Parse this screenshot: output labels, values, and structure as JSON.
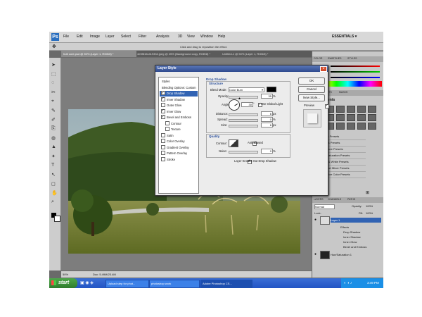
{
  "menubar": {
    "logo": "Ps",
    "items": [
      "File",
      "Edit",
      "Image",
      "Layer",
      "Select",
      "Filter",
      "Analysis",
      "3D",
      "View",
      "Window",
      "Help"
    ],
    "workspace": "ESSENTIALS ▾"
  },
  "options_bar": {
    "hint": "Click and drag to reposition the effect."
  },
  "doc_tabs": [
    "hutt core.psd @ 50% (Layer 1, RGB/8) *",
    "4e5f815c419332.jpeg @ 25% (Background copy, RGB/8) *",
    "Untitled-1 @ 50% (Layer 1, RGB/8) *"
  ],
  "status": {
    "zoom": "50%",
    "doc": "Doc: 5.49M/23.4M"
  },
  "panels": {
    "top_tabs": [
      "COLOR",
      "SWATCHES",
      "STYLES"
    ],
    "mid_tabs": [
      "ADJUSTMENTS",
      "MASKS"
    ],
    "adjustments_title": "Adjustments",
    "presets": [
      "Levels Presets",
      "Curves Presets",
      "Exposure Presets",
      "Hue/Saturation Presets",
      "Black & White Presets",
      "Channel Mixer Presets",
      "Selective Color Presets"
    ],
    "layer_tabs": [
      "LAYERS",
      "CHANNELS",
      "PATHS"
    ],
    "blend_mode": "Normal",
    "opacity_label": "Opacity:",
    "opacity_value": "100%",
    "lock_label": "Lock:",
    "fill_label": "Fill:",
    "fill_value": "100%",
    "layers": [
      "Layer 1",
      "Effects",
      "Drop Shadow",
      "Inner Shadow",
      "Inner Glow",
      "Bevel and Emboss",
      "Hue/Saturation 1"
    ]
  },
  "dialog": {
    "title": "Layer Style",
    "styles": [
      {
        "label": "Styles",
        "checkbox": false
      },
      {
        "label": "Blending Options: Custom",
        "checkbox": false
      },
      {
        "label": "Drop Shadow",
        "checkbox": true,
        "checked": true,
        "selected": true
      },
      {
        "label": "Inner Shadow",
        "checkbox": true,
        "checked": true
      },
      {
        "label": "Outer Glow",
        "checkbox": true,
        "checked": false
      },
      {
        "label": "Inner Glow",
        "checkbox": true,
        "checked": true
      },
      {
        "label": "Bevel and Emboss",
        "checkbox": true,
        "checked": true
      },
      {
        "label": "Contour",
        "checkbox": true,
        "checked": false,
        "indent": true
      },
      {
        "label": "Texture",
        "checkbox": true,
        "checked": false,
        "indent": true
      },
      {
        "label": "Satin",
        "checkbox": true,
        "checked": false
      },
      {
        "label": "Color Overlay",
        "checkbox": true,
        "checked": false
      },
      {
        "label": "Gradient Overlay",
        "checkbox": true,
        "checked": false
      },
      {
        "label": "Pattern Overlay",
        "checkbox": true,
        "checked": false
      },
      {
        "label": "Stroke",
        "checkbox": true,
        "checked": false
      }
    ],
    "section": "Drop Shadow",
    "structure_label": "Structure",
    "blend_mode_label": "Blend Mode:",
    "blend_mode_value": "Color Burn",
    "shadow_color": "#000000",
    "opacity_label": "Opacity:",
    "opacity_value": "35",
    "angle_label": "Angle:",
    "angle_value": "30",
    "global_light_label": "Use Global Light",
    "distance_label": "Distance:",
    "distance_value": "6",
    "spread_label": "Spread:",
    "spread_value": "0",
    "size_label": "Size:",
    "size_value": "6",
    "quality_label": "Quality",
    "contour_label": "Contour:",
    "anti_aliased_label": "Anti-aliased",
    "noise_label": "Noise:",
    "noise_value": "0",
    "knockout_label": "Layer Knocks Out Drop Shadow",
    "unit_pct": "%",
    "unit_px": "px",
    "unit_deg": "°",
    "ok_label": "OK",
    "cancel_label": "Cancel",
    "new_style_label": "New Style...",
    "preview_label": "Preview"
  },
  "taskbar": {
    "start": "start",
    "items": [
      "Upload step for phot...",
      "photoshop work",
      "Adobe Photoshop CS..."
    ],
    "clock": "3:49 PM"
  },
  "colors": {
    "accent": "#3163b3",
    "dialog_title": "#2f4b8f",
    "taskbar": "#2254c4",
    "start": "#2f7c2c"
  }
}
